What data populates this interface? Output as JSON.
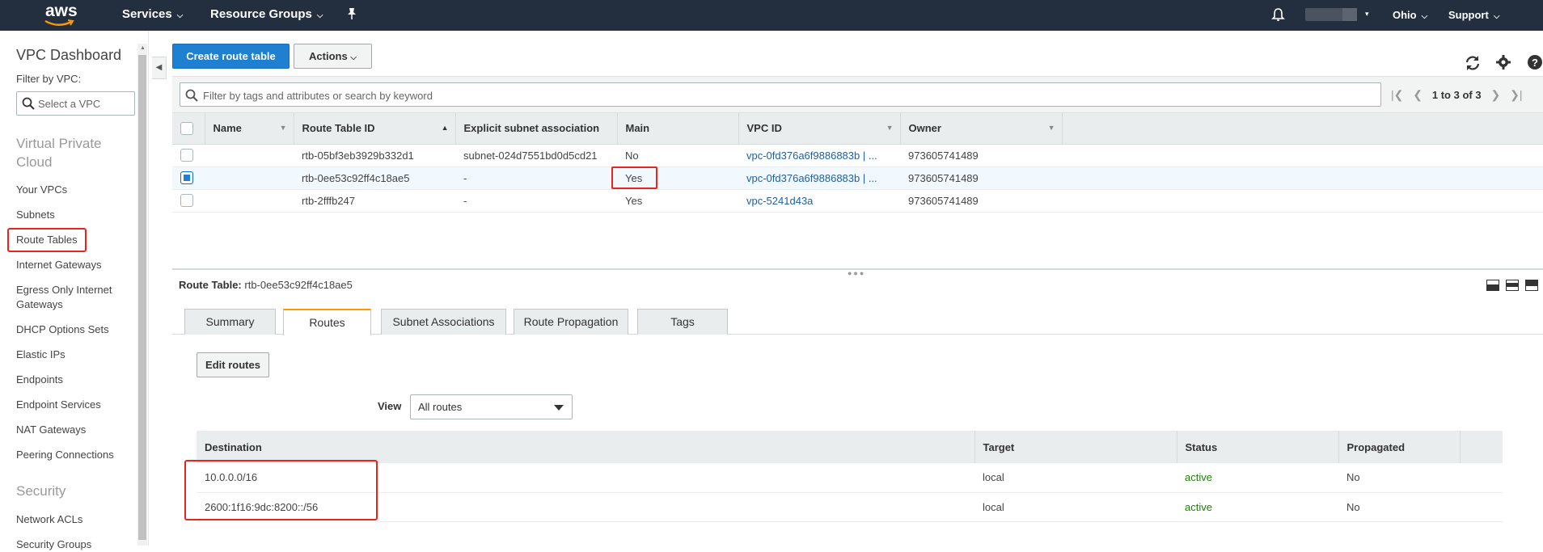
{
  "topnav": {
    "logo_text": "aws",
    "services": "Services",
    "resource_groups": "Resource Groups",
    "region": "Ohio",
    "support": "Support"
  },
  "sidebar": {
    "title": "VPC Dashboard",
    "filter_label": "Filter by VPC:",
    "vpc_placeholder": "Select a VPC",
    "section_vpc": "Virtual Private Cloud",
    "items": [
      "Your VPCs",
      "Subnets",
      "Route Tables",
      "Internet Gateways",
      "Egress Only Internet Gateways",
      "DHCP Options Sets",
      "Elastic IPs",
      "Endpoints",
      "Endpoint Services",
      "NAT Gateways",
      "Peering Connections"
    ],
    "section_security": "Security",
    "security_items": [
      "Network ACLs",
      "Security Groups"
    ]
  },
  "toolbar": {
    "create_label": "Create route table",
    "actions_label": "Actions"
  },
  "filter": {
    "placeholder": "Filter by tags and attributes or search by keyword",
    "pager_text": "1 to 3 of 3"
  },
  "table": {
    "headers": [
      "Name",
      "Route Table ID",
      "Explicit subnet association",
      "Main",
      "VPC ID",
      "Owner"
    ],
    "rows": [
      {
        "name": "",
        "id": "rtb-05bf3eb3929b332d1",
        "subnet": "subnet-024d7551bd0d5cd21",
        "main": "No",
        "vpc": "vpc-0fd376a6f9886883b | ...",
        "owner": "973605741489"
      },
      {
        "name": "",
        "id": "rtb-0ee53c92ff4c18ae5",
        "subnet": "-",
        "main": "Yes",
        "vpc": "vpc-0fd376a6f9886883b | ...",
        "owner": "973605741489"
      },
      {
        "name": "",
        "id": "rtb-2fffb247",
        "subnet": "-",
        "main": "Yes",
        "vpc": "vpc-5241d43a",
        "owner": "973605741489"
      }
    ]
  },
  "detail": {
    "label": "Route Table:",
    "value": "rtb-0ee53c92ff4c18ae5",
    "tabs": [
      "Summary",
      "Routes",
      "Subnet Associations",
      "Route Propagation",
      "Tags"
    ],
    "active_tab": "Routes",
    "edit_label": "Edit routes",
    "view_label": "View",
    "view_value": "All routes"
  },
  "routes": {
    "headers": [
      "Destination",
      "Target",
      "Status",
      "Propagated"
    ],
    "rows": [
      {
        "destination": "10.0.0.0/16",
        "target": "local",
        "status": "active",
        "propagated": "No"
      },
      {
        "destination": "2600:1f16:9dc:8200::/56",
        "target": "local",
        "status": "active",
        "propagated": "No"
      }
    ]
  },
  "colors": {
    "nav_bg": "#232f3e",
    "primary": "#1f7fd1",
    "highlight": "#e4261f",
    "active_status": "#1d8102",
    "tab_accent": "#ff9900"
  }
}
